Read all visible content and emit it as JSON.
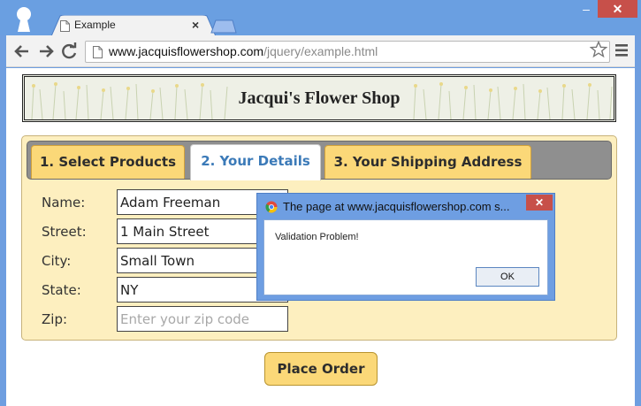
{
  "browser": {
    "tab_title": "Example",
    "tab_close": "×",
    "window_minimize": "–",
    "window_close": "✕",
    "url_host": "www.jacquisflowershop.com",
    "url_path": "/jquery/example.html"
  },
  "page": {
    "banner_title": "Jacqui's Flower Shop",
    "tabs": [
      {
        "label": "1. Select Products",
        "active": false
      },
      {
        "label": "2. Your Details",
        "active": true
      },
      {
        "label": "3. Your Shipping Address",
        "active": false
      }
    ],
    "form": {
      "name": {
        "label": "Name:",
        "value": "Adam Freeman"
      },
      "street": {
        "label": "Street:",
        "value": "1 Main Street"
      },
      "city": {
        "label": "City:",
        "value": "Small Town"
      },
      "state": {
        "label": "State:",
        "value": "NY"
      },
      "zip": {
        "label": "Zip:",
        "value": "",
        "placeholder": "Enter your zip code"
      }
    },
    "place_order_label": "Place Order"
  },
  "dialog": {
    "title": "The page at www.jacquisflowershop.com s...",
    "close": "✕",
    "message": "Validation Problem!",
    "ok_label": "OK"
  },
  "colors": {
    "tab_inactive": "#fbd878",
    "tab_active_text": "#3b7ab8",
    "panel_bg": "#fdefbf",
    "chrome_blue": "#6a9fe1",
    "close_red": "#c7504a"
  }
}
